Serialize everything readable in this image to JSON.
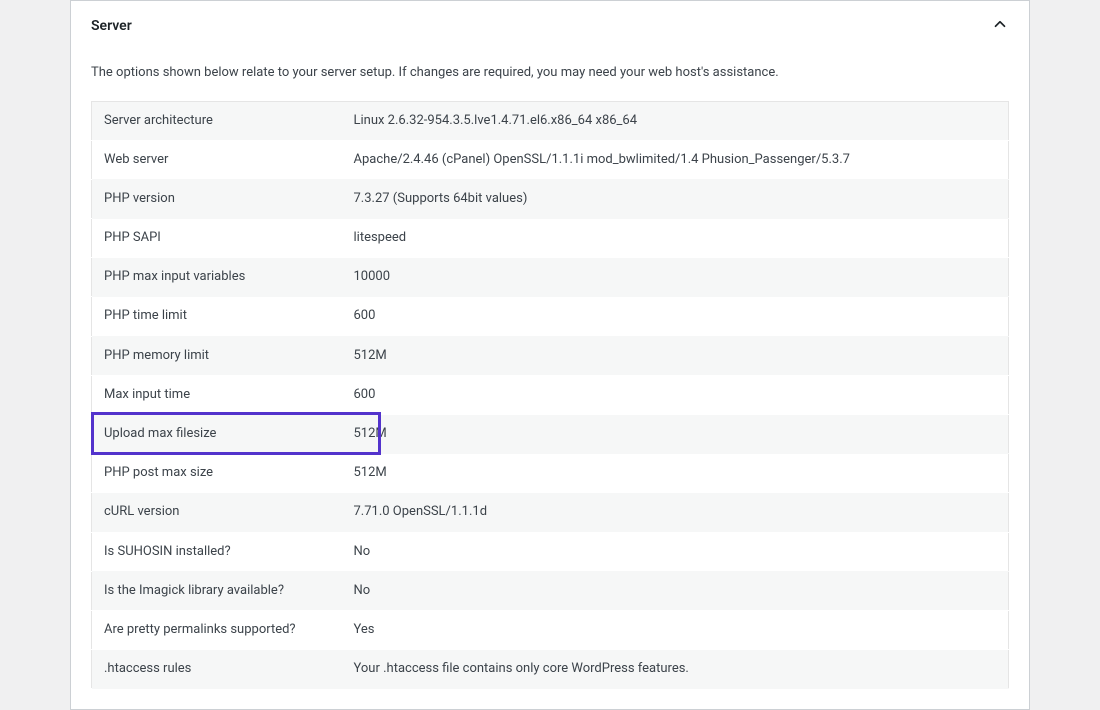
{
  "panel": {
    "title": "Server",
    "description": "The options shown below relate to your server setup. If changes are required, you may need your web host's assistance.",
    "rows": [
      {
        "label": "Server architecture",
        "value": "Linux 2.6.32-954.3.5.lve1.4.71.el6.x86_64 x86_64"
      },
      {
        "label": "Web server",
        "value": "Apache/2.4.46 (cPanel) OpenSSL/1.1.1i mod_bwlimited/1.4 Phusion_Passenger/5.3.7"
      },
      {
        "label": "PHP version",
        "value": "7.3.27 (Supports 64bit values)"
      },
      {
        "label": "PHP SAPI",
        "value": "litespeed"
      },
      {
        "label": "PHP max input variables",
        "value": "10000"
      },
      {
        "label": "PHP time limit",
        "value": "600"
      },
      {
        "label": "PHP memory limit",
        "value": "512M"
      },
      {
        "label": "Max input time",
        "value": "600"
      },
      {
        "label": "Upload max filesize",
        "value": "512M"
      },
      {
        "label": "PHP post max size",
        "value": "512M"
      },
      {
        "label": "cURL version",
        "value": "7.71.0 OpenSSL/1.1.1d"
      },
      {
        "label": "Is SUHOSIN installed?",
        "value": "No"
      },
      {
        "label": "Is the Imagick library available?",
        "value": "No"
      },
      {
        "label": "Are pretty permalinks supported?",
        "value": "Yes"
      },
      {
        "label": ".htaccess rules",
        "value": "Your .htaccess file contains only core WordPress features."
      }
    ],
    "highlightRowIndex": 8,
    "highlightColor": "#5333cc"
  }
}
